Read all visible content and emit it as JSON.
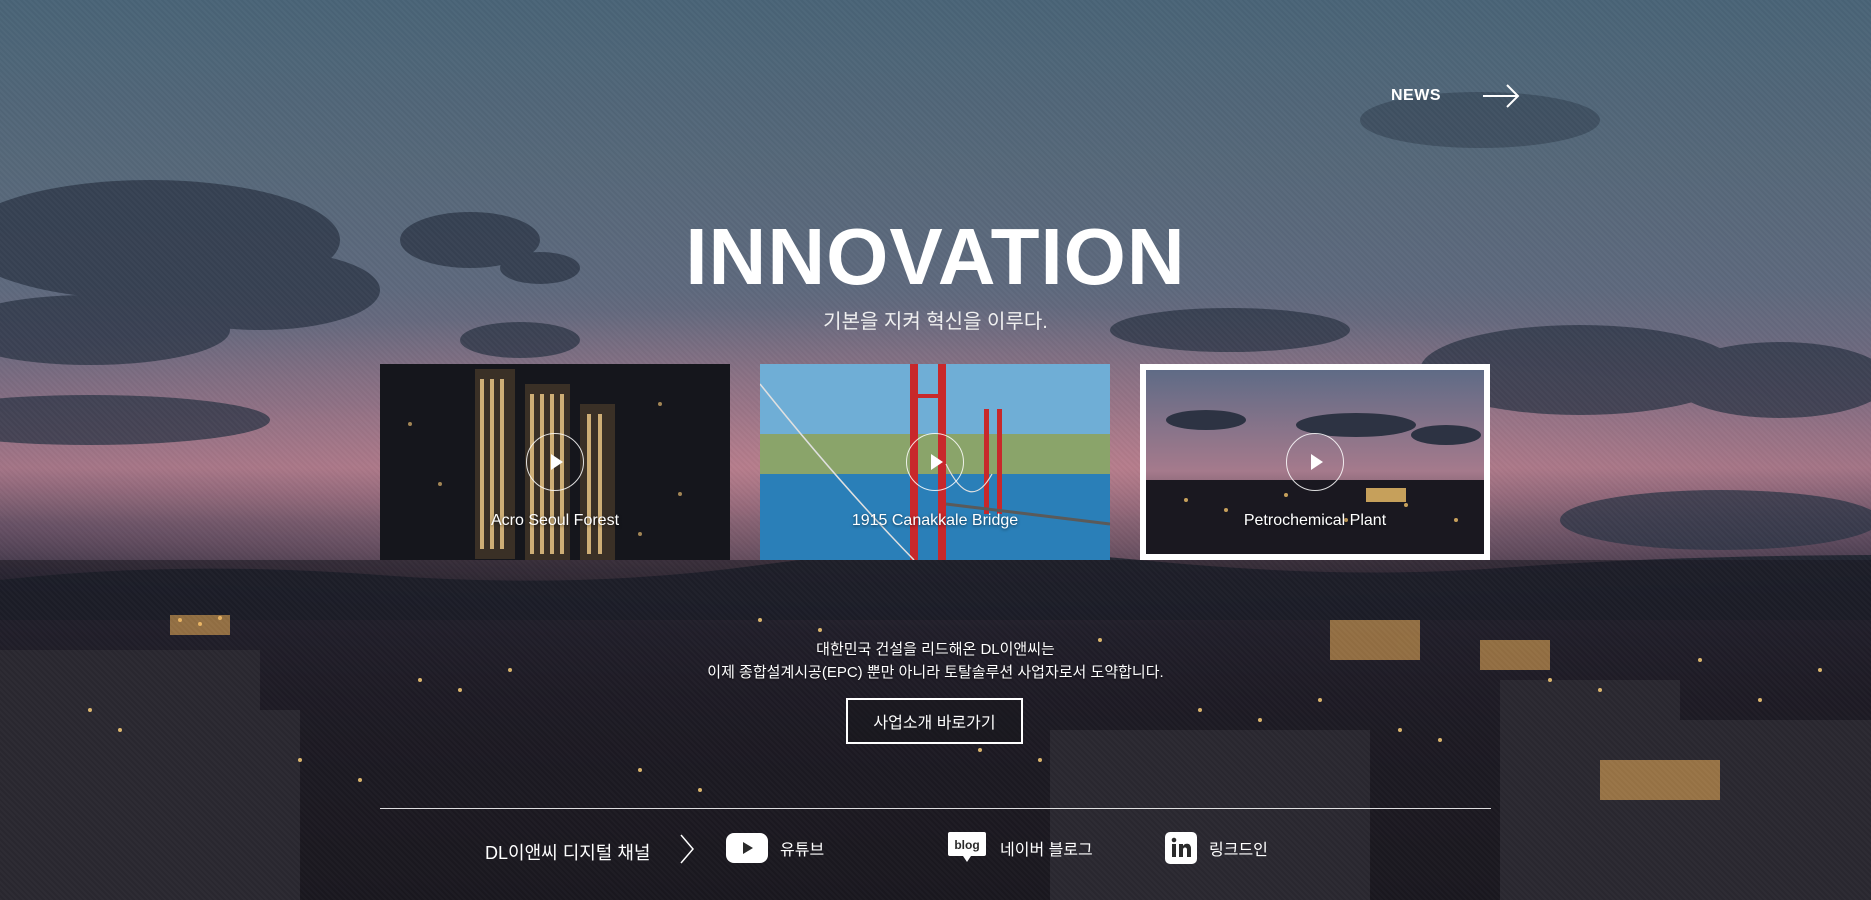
{
  "header": {
    "news_label": "NEWS"
  },
  "hero": {
    "title": "INNOVATION",
    "subtitle": "기본을 지켜 혁신을 이루다."
  },
  "cards": [
    {
      "caption": "Acro Seoul Forest",
      "selected": false
    },
    {
      "caption": "1915 Canakkale Bridge",
      "selected": false
    },
    {
      "caption": "Petrochemical Plant",
      "selected": true
    }
  ],
  "description": {
    "line1": "대한민국 건설을 리드해온 DL이앤씨는",
    "line2": "이제 종합설계시공(EPC) 뿐만 아니라 토탈솔루션 사업자로서 도약합니다."
  },
  "business_button": {
    "label": "사업소개 바로가기"
  },
  "channels": {
    "title": "DL이앤씨 디지털 채널",
    "items": [
      {
        "label": "유튜브",
        "icon": "youtube-icon"
      },
      {
        "label": "네이버 블로그",
        "icon": "blog-icon"
      },
      {
        "label": "링크드인",
        "icon": "linkedin-icon"
      }
    ]
  },
  "colors": {
    "accent_red": "#c8282b",
    "sea_blue": "#2a7fb8",
    "text": "#ffffff"
  }
}
